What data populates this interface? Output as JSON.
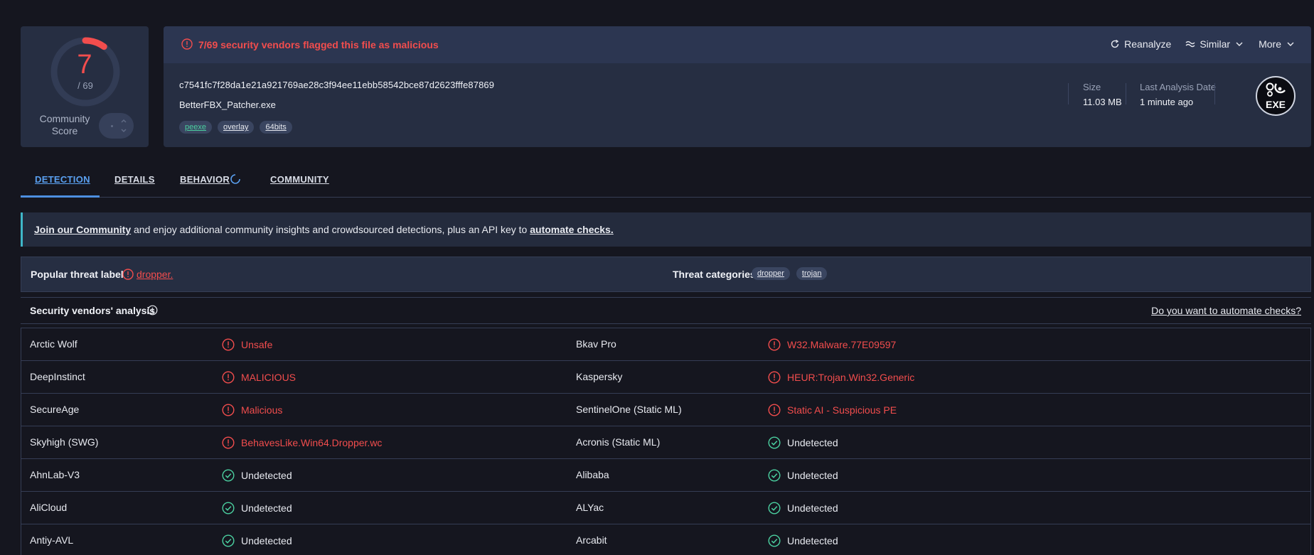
{
  "score": {
    "detected": "7",
    "total": "/ 69",
    "community_label": "Community Score",
    "ring_fraction": 0.1014
  },
  "file": {
    "flag_message": "7/69 security vendors flagged this file as malicious",
    "hash": "c7541fc7f28da1e21a921769ae28c3f94ee11ebb58542bce87d2623fffe87869",
    "name": "BetterFBX_Patcher.exe",
    "tags": [
      "peexe",
      "overlay",
      "64bits"
    ],
    "size_label": "Size",
    "size_value": "11.03 MB",
    "date_label": "Last Analysis Date",
    "date_value": "1 minute ago",
    "type_badge": "EXE"
  },
  "actions": {
    "reanalyze": "Reanalyze",
    "similar": "Similar",
    "more": "More"
  },
  "tabs": [
    "DETECTION",
    "DETAILS",
    "BEHAVIOR",
    "COMMUNITY"
  ],
  "banner": {
    "link1": "Join our Community",
    "middle": " and enjoy additional community insights and crowdsourced detections, plus an API key to ",
    "link2": "automate checks."
  },
  "threat": {
    "popular_label": "Popular threat label",
    "popular_value": "dropper.",
    "categories_label": "Threat categories",
    "categories": [
      "dropper",
      "trojan"
    ]
  },
  "vendors_header": {
    "title": "Security vendors' analysis",
    "automate_link": "Do you want to automate checks?"
  },
  "vendors": [
    [
      {
        "name": "Arctic Wolf",
        "result": "Unsafe",
        "status": "bad"
      },
      {
        "name": "Bkav Pro",
        "result": "W32.Malware.77E09597",
        "status": "bad"
      }
    ],
    [
      {
        "name": "DeepInstinct",
        "result": "MALICIOUS",
        "status": "bad"
      },
      {
        "name": "Kaspersky",
        "result": "HEUR:Trojan.Win32.Generic",
        "status": "bad"
      }
    ],
    [
      {
        "name": "SecureAge",
        "result": "Malicious",
        "status": "bad"
      },
      {
        "name": "SentinelOne (Static ML)",
        "result": "Static AI - Suspicious PE",
        "status": "bad"
      }
    ],
    [
      {
        "name": "Skyhigh (SWG)",
        "result": "BehavesLike.Win64.Dropper.wc",
        "status": "bad"
      },
      {
        "name": "Acronis (Static ML)",
        "result": "Undetected",
        "status": "ok"
      }
    ],
    [
      {
        "name": "AhnLab-V3",
        "result": "Undetected",
        "status": "ok"
      },
      {
        "name": "Alibaba",
        "result": "Undetected",
        "status": "ok"
      }
    ],
    [
      {
        "name": "AliCloud",
        "result": "Undetected",
        "status": "ok"
      },
      {
        "name": "ALYac",
        "result": "Undetected",
        "status": "ok"
      }
    ],
    [
      {
        "name": "Antiy-AVL",
        "result": "Undetected",
        "status": "ok"
      },
      {
        "name": "Arcabit",
        "result": "Undetected",
        "status": "ok"
      }
    ]
  ],
  "colors": {
    "malicious": "#f24d4d",
    "clean": "#4bd0a0",
    "accent": "#5aa0f0",
    "panel": "#262e42"
  }
}
